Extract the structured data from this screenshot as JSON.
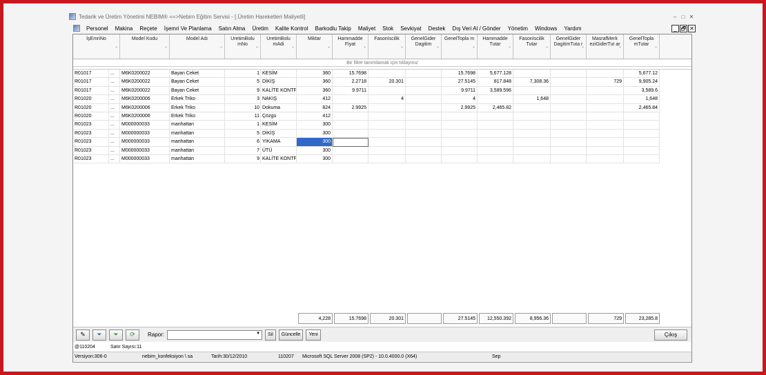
{
  "window": {
    "title": "Tedarik ve Üretim Yönetimi   NEBIM®  ==>Nebim Eğitim Servisi - [.Üretim Hareketleri Maliyetli]",
    "min": "–",
    "max": "□",
    "close": "✕"
  },
  "menu": [
    "Personel",
    "Makina",
    "Reçete",
    "İşemri Ve Planlama",
    "Satın Alma",
    "Üretim",
    "Kalite Kontrol",
    "Barkodlu Takip",
    "Maliyet",
    "Stok",
    "Sevkiyat",
    "Destek",
    "Dış Veri Al / Gönder",
    "Yönetim",
    "Windows",
    "Yardım"
  ],
  "mdi": {
    "min": "_",
    "restore": "🗗",
    "close": "✕"
  },
  "grid": {
    "columns": [
      {
        "label": "İşEmriNo"
      },
      {
        "label": "Model Kodu"
      },
      {
        "label": "Model Adı"
      },
      {
        "label": "UretimBolu mNo"
      },
      {
        "label": "UretimBolu mAdi"
      },
      {
        "label": "Miktar"
      },
      {
        "label": "Hammadde Fiyat"
      },
      {
        "label": "FasonIscilik"
      },
      {
        "label": "GenelGider Dagitim"
      },
      {
        "label": "GenelTopla m"
      },
      {
        "label": "Hammadde Tutar"
      },
      {
        "label": "FasonIscilik Tutar"
      },
      {
        "label": "GenelGider DagitimTuta r"
      },
      {
        "label": "MasrafMerk eziGiderTut ar"
      },
      {
        "label": "GenelTopla mTutar"
      }
    ],
    "filter_hint": "Bir filtre tanımlamak için tıklayınız",
    "rows": [
      [
        "R01017",
        "...",
        "M6K0200022",
        "Bayan Ceket",
        "1",
        "KESİM",
        "360",
        "15.7698",
        "",
        "",
        "15.7698",
        "5,677.128",
        "",
        "",
        "",
        "5,677.12"
      ],
      [
        "R01017",
        "...",
        "M6K0200022",
        "Bayan Ceket",
        "5",
        "DİKİŞ",
        "360",
        "2.2718",
        "20.301",
        "",
        "27.5145",
        "817.848",
        "7,308.36",
        "",
        "729",
        "9,905.24"
      ],
      [
        "R01017",
        "...",
        "M6K0200022",
        "Bayan Ceket",
        "9",
        "KALİTE KONTF",
        "360",
        "9.9711",
        "",
        "",
        "9.9711",
        "3,589.596",
        "",
        "",
        "",
        "3,589.6"
      ],
      [
        "R01020",
        "...",
        "M6K0200006",
        "Erkek Triko",
        "3",
        "NAKIŞ",
        "412",
        "",
        "4",
        "",
        "4",
        "",
        "1,648",
        "",
        "",
        "1,648"
      ],
      [
        "R01020",
        "...",
        "M6K0200006",
        "Erkek Triko",
        "10",
        "Dokuma",
        "824",
        "2.9925",
        "",
        "",
        "2.9925",
        "2,465.82",
        "",
        "",
        "",
        "2,465.84"
      ],
      [
        "R01020",
        "...",
        "M6K0200006",
        "Erkek Triko",
        "11",
        "Çözgü",
        "412",
        "",
        "",
        "",
        "",
        "",
        "",
        "",
        "",
        ""
      ],
      [
        "R01023",
        "...",
        "M000000033",
        "manhattan",
        "1",
        "KESİM",
        "300",
        "",
        "",
        "",
        "",
        "",
        "",
        "",
        "",
        ""
      ],
      [
        "R01023",
        "...",
        "M000000033",
        "manhattan",
        "5",
        "DİKİŞ",
        "300",
        "",
        "",
        "",
        "",
        "",
        "",
        "",
        "",
        ""
      ],
      [
        "R01023",
        "...",
        "M000000033",
        "manhattan",
        "6",
        "YIKAMA",
        "300",
        "",
        "",
        "",
        "",
        "",
        "",
        "",
        "",
        ""
      ],
      [
        "R01023",
        "...",
        "M000000033",
        "manhattan",
        "7",
        "ÜTÜ",
        "300",
        "",
        "",
        "",
        "",
        "",
        "",
        "",
        "",
        ""
      ],
      [
        "R01023",
        "...",
        "M000000033",
        "manhattan",
        "9",
        "KALİTE KONTF",
        "300",
        "",
        "",
        "",
        "",
        "",
        "",
        "",
        "",
        ""
      ]
    ],
    "totals": [
      "4,228",
      "15.7698",
      "20.301",
      "",
      "27.5145",
      "12,550.392",
      "8,956.36",
      "",
      "729",
      "23,285.8"
    ]
  },
  "toolbar": {
    "rapor_label": "Rapor:",
    "rapor_value": "",
    "sil": "Sil",
    "guncelle": "Güncelle",
    "yeni": "Yeni",
    "cikis": "Çıkış"
  },
  "status": {
    "code": "@110204",
    "row_count": "Satır Sayısı:11",
    "version": "Versiyon:306-0",
    "db": "nebim_konfeksiyon \\ sa",
    "date": "Tarih:30/12/2010",
    "num": "110207",
    "server": "Microsoft SQL Server 2008 (SP2) - 10.0.4000.0 (X64)",
    "month": "Sep"
  }
}
